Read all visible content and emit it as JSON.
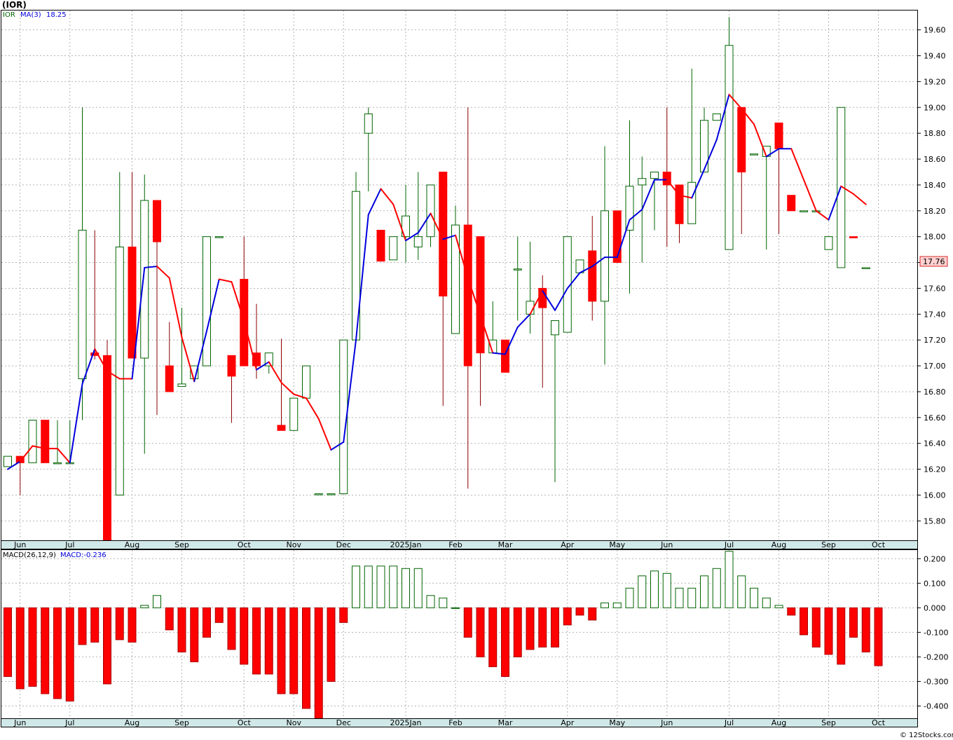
{
  "chart_title": "(IOR)",
  "credit": "© 12Stocks.com",
  "colors": {
    "up": "#006400",
    "down": "#ff0000",
    "ma_up": "#0000dd",
    "ma_down": "#ff0000",
    "grid": "#b4b4b4",
    "axis_band": "#d0e8e8",
    "frame": "#000000",
    "last_label_bg": "#ffd0d0"
  },
  "chart_data": [
    {
      "type": "candlestick",
      "ticker": "IOR",
      "legend": {
        "ticker": "IOR",
        "ma_label": "MA(3)",
        "ma_value": "18.25"
      },
      "ylim": [
        15.65,
        19.75
      ],
      "y_ticks": [
        "15.80",
        "16.00",
        "16.20",
        "16.40",
        "16.60",
        "16.80",
        "17.00",
        "17.20",
        "17.40",
        "17.60",
        "17.80",
        "18.00",
        "18.20",
        "18.40",
        "18.60",
        "18.80",
        "19.00",
        "19.20",
        "19.40",
        "19.60"
      ],
      "last_price": "17.76",
      "month_labels": [
        {
          "label": "Jun",
          "week": 1
        },
        {
          "label": "Jul",
          "week": 5
        },
        {
          "label": "Aug",
          "week": 10
        },
        {
          "label": "Sep",
          "week": 14
        },
        {
          "label": "Oct",
          "week": 19
        },
        {
          "label": "Nov",
          "week": 23
        },
        {
          "label": "Dec",
          "week": 27
        },
        {
          "label": "2025Jan",
          "week": 32
        },
        {
          "label": "Feb",
          "week": 36
        },
        {
          "label": "Mar",
          "week": 40
        },
        {
          "label": "Apr",
          "week": 45
        },
        {
          "label": "May",
          "week": 49
        },
        {
          "label": "Jun",
          "week": 53
        },
        {
          "label": "Jul",
          "week": 58
        },
        {
          "label": "Aug",
          "week": 62
        },
        {
          "label": "Sep",
          "week": 66
        },
        {
          "label": "Oct",
          "week": 70
        }
      ],
      "candles": [
        {
          "o": 16.22,
          "h": 16.3,
          "l": 16.22,
          "c": 16.3
        },
        {
          "o": 16.3,
          "h": 16.3,
          "l": 16.0,
          "c": 16.25
        },
        {
          "o": 16.25,
          "h": 16.58,
          "l": 16.25,
          "c": 16.58
        },
        {
          "o": 16.58,
          "h": 16.58,
          "l": 16.25,
          "c": 16.25
        },
        {
          "o": 16.25,
          "h": 16.58,
          "l": 16.25,
          "c": 16.25
        },
        {
          "o": 16.25,
          "h": 16.58,
          "l": 16.25,
          "c": 16.25
        },
        {
          "o": 16.9,
          "h": 19.0,
          "l": 16.58,
          "c": 18.05
        },
        {
          "o": 17.1,
          "h": 18.05,
          "l": 17.05,
          "c": 17.08
        },
        {
          "o": 17.08,
          "h": 17.2,
          "l": 15.65,
          "c": 15.65
        },
        {
          "o": 16.0,
          "h": 18.5,
          "l": 16.0,
          "c": 17.92
        },
        {
          "o": 17.92,
          "h": 18.5,
          "l": 17.06,
          "c": 17.06
        },
        {
          "o": 17.06,
          "h": 18.48,
          "l": 16.32,
          "c": 18.28
        },
        {
          "o": 18.28,
          "h": 18.28,
          "l": 16.62,
          "c": 17.96
        },
        {
          "o": 17.0,
          "h": 17.34,
          "l": 16.8,
          "c": 16.8
        },
        {
          "o": 16.84,
          "h": 17.45,
          "l": 16.84,
          "c": 16.86
        },
        {
          "o": 16.9,
          "h": 17.0,
          "l": 16.9,
          "c": 17.0
        },
        {
          "o": 17.0,
          "h": 18.0,
          "l": 17.0,
          "c": 18.0
        },
        {
          "o": 18.0,
          "h": 18.0,
          "l": 18.0,
          "c": 18.0
        },
        {
          "o": 17.08,
          "h": 17.05,
          "l": 16.56,
          "c": 16.92
        },
        {
          "o": 17.67,
          "h": 18.0,
          "l": 17.0,
          "c": 17.0
        },
        {
          "o": 17.1,
          "h": 17.48,
          "l": 16.9,
          "c": 17.0
        },
        {
          "o": 17.0,
          "h": 17.1,
          "l": 16.94,
          "c": 17.1
        },
        {
          "o": 16.54,
          "h": 17.21,
          "l": 16.5,
          "c": 16.5
        },
        {
          "o": 16.5,
          "h": 16.75,
          "l": 16.5,
          "c": 16.75
        },
        {
          "o": 16.75,
          "h": 17.0,
          "l": 16.75,
          "c": 17.0
        },
        {
          "o": 16.01,
          "h": 16.01,
          "l": 16.01,
          "c": 16.01
        },
        {
          "o": 16.01,
          "h": 16.01,
          "l": 16.01,
          "c": 16.01
        },
        {
          "o": 16.01,
          "h": 17.2,
          "l": 16.01,
          "c": 17.2
        },
        {
          "o": 17.2,
          "h": 18.5,
          "l": 17.2,
          "c": 18.35
        },
        {
          "o": 18.8,
          "h": 19.0,
          "l": 18.35,
          "c": 18.95
        },
        {
          "o": 18.05,
          "h": 18.05,
          "l": 17.81,
          "c": 17.81
        },
        {
          "o": 17.82,
          "h": 18.0,
          "l": 17.82,
          "c": 18.0
        },
        {
          "o": 18.0,
          "h": 18.4,
          "l": 17.8,
          "c": 18.16
        },
        {
          "o": 17.92,
          "h": 18.5,
          "l": 17.82,
          "c": 18.0
        },
        {
          "o": 18.0,
          "h": 18.4,
          "l": 17.92,
          "c": 18.4
        },
        {
          "o": 18.5,
          "h": 18.5,
          "l": 16.69,
          "c": 17.54
        },
        {
          "o": 17.25,
          "h": 18.24,
          "l": 17.25,
          "c": 18.09
        },
        {
          "o": 18.09,
          "h": 19.0,
          "l": 16.05,
          "c": 17.0
        },
        {
          "o": 18.0,
          "h": 18.0,
          "l": 16.69,
          "c": 17.1
        },
        {
          "o": 17.1,
          "h": 17.5,
          "l": 17.1,
          "c": 17.2
        },
        {
          "o": 17.2,
          "h": 17.2,
          "l": 16.95,
          "c": 16.95
        },
        {
          "o": 17.75,
          "h": 18.0,
          "l": 17.35,
          "c": 17.75
        },
        {
          "o": 17.4,
          "h": 17.96,
          "l": 17.25,
          "c": 17.5
        },
        {
          "o": 17.6,
          "h": 17.7,
          "l": 16.83,
          "c": 17.45
        },
        {
          "o": 17.24,
          "h": 17.35,
          "l": 16.1,
          "c": 17.35
        },
        {
          "o": 17.26,
          "h": 18.0,
          "l": 17.26,
          "c": 18.0
        },
        {
          "o": 17.72,
          "h": 17.82,
          "l": 17.72,
          "c": 17.82
        },
        {
          "o": 17.89,
          "h": 18.16,
          "l": 17.35,
          "c": 17.5
        },
        {
          "o": 17.5,
          "h": 18.7,
          "l": 17.01,
          "c": 18.2
        },
        {
          "o": 18.2,
          "h": 18.2,
          "l": 17.8,
          "c": 17.8
        },
        {
          "o": 18.05,
          "h": 18.9,
          "l": 17.56,
          "c": 18.39
        },
        {
          "o": 18.4,
          "h": 18.62,
          "l": 17.8,
          "c": 18.45
        },
        {
          "o": 18.45,
          "h": 18.5,
          "l": 18.05,
          "c": 18.5
        },
        {
          "o": 18.5,
          "h": 19.0,
          "l": 17.92,
          "c": 18.4
        },
        {
          "o": 18.4,
          "h": 18.4,
          "l": 17.95,
          "c": 18.1
        },
        {
          "o": 18.1,
          "h": 19.3,
          "l": 18.1,
          "c": 18.42
        },
        {
          "o": 18.5,
          "h": 19.0,
          "l": 18.5,
          "c": 18.9
        },
        {
          "o": 18.9,
          "h": 18.95,
          "l": 18.9,
          "c": 18.95
        },
        {
          "o": 17.9,
          "h": 19.7,
          "l": 17.9,
          "c": 19.48
        },
        {
          "o": 19.0,
          "h": 19.0,
          "l": 18.02,
          "c": 18.5
        },
        {
          "o": 18.64,
          "h": 18.64,
          "l": 18.64,
          "c": 18.64
        },
        {
          "o": 18.62,
          "h": 18.7,
          "l": 17.9,
          "c": 18.7
        },
        {
          "o": 18.88,
          "h": 18.88,
          "l": 18.02,
          "c": 18.68
        },
        {
          "o": 18.32,
          "h": 18.32,
          "l": 18.2,
          "c": 18.2
        },
        {
          "o": 18.2,
          "h": 18.2,
          "l": 18.2,
          "c": 18.2
        },
        {
          "o": 18.2,
          "h": 18.2,
          "l": 18.2,
          "c": 18.2
        },
        {
          "o": 17.9,
          "h": 18.0,
          "l": 17.9,
          "c": 18.0
        },
        {
          "o": 17.76,
          "h": 19.0,
          "l": 17.76,
          "c": 19.0
        },
        {
          "o": 18.0,
          "h": 18.0,
          "l": 17.99,
          "c": 17.99
        },
        {
          "o": 17.76,
          "h": 17.76,
          "l": 17.76,
          "c": 17.76
        }
      ],
      "ma3": [
        16.2,
        16.26,
        16.38,
        16.36,
        16.36,
        16.25,
        16.86,
        17.13,
        16.96,
        16.9,
        16.9,
        17.76,
        17.77,
        17.68,
        17.22,
        16.88,
        17.27,
        17.67,
        17.65,
        17.35,
        16.97,
        17.03,
        16.87,
        16.78,
        16.75,
        16.59,
        16.35,
        16.41,
        17.2,
        18.17,
        18.37,
        18.25,
        17.97,
        18.03,
        18.18,
        17.98,
        18.01,
        17.68,
        17.39,
        17.1,
        17.09,
        17.3,
        17.4,
        17.58,
        17.43,
        17.6,
        17.72,
        17.77,
        17.84,
        17.84,
        18.13,
        18.21,
        18.44,
        18.44,
        18.32,
        18.3,
        18.52,
        18.75,
        19.1,
        18.99,
        18.87,
        18.62,
        18.68,
        18.68,
        18.44,
        18.2,
        18.13,
        18.39,
        18.33,
        18.25
      ],
      "ma_colors": [
        "b",
        "b",
        "r",
        "r",
        "r",
        "r",
        "b",
        "b",
        "r",
        "r",
        "r",
        "b",
        "b",
        "r",
        "r",
        "r",
        "b",
        "b",
        "r",
        "r",
        "r",
        "b",
        "r",
        "r",
        "r",
        "r",
        "r",
        "b",
        "b",
        "b",
        "b",
        "r",
        "r",
        "b",
        "b",
        "r",
        "b",
        "r",
        "r",
        "r",
        "b",
        "b",
        "b",
        "r",
        "b",
        "b",
        "b",
        "b",
        "b",
        "b",
        "b",
        "b",
        "b",
        "b",
        "r",
        "r",
        "b",
        "b",
        "b",
        "r",
        "r",
        "r",
        "b",
        "b",
        "r",
        "r",
        "r",
        "b",
        "r",
        "r"
      ]
    },
    {
      "type": "bar",
      "name": "MACD",
      "legend": {
        "label": "MACD(26,12,9)",
        "value_label": "MACD:-0.236"
      },
      "ylim": [
        -0.45,
        0.235
      ],
      "y_ticks": [
        "0.200",
        "0.100",
        "0.000",
        "-0.100",
        "-0.200",
        "-0.300",
        "-0.400"
      ],
      "values": [
        -0.28,
        -0.33,
        -0.32,
        -0.35,
        -0.37,
        -0.38,
        -0.15,
        -0.14,
        -0.31,
        -0.13,
        -0.14,
        0.01,
        0.05,
        -0.09,
        -0.18,
        -0.22,
        -0.12,
        -0.06,
        -0.17,
        -0.23,
        -0.27,
        -0.27,
        -0.35,
        -0.35,
        -0.41,
        -0.45,
        -0.3,
        -0.06,
        0.17,
        0.17,
        0.17,
        0.17,
        0.16,
        0.16,
        0.05,
        0.04,
        0.0,
        -0.12,
        -0.2,
        -0.24,
        -0.28,
        -0.2,
        -0.17,
        -0.16,
        -0.16,
        -0.07,
        -0.03,
        -0.05,
        0.02,
        0.02,
        0.08,
        0.13,
        0.15,
        0.14,
        0.08,
        0.08,
        0.13,
        0.16,
        0.23,
        0.13,
        0.08,
        0.04,
        0.01,
        -0.03,
        -0.11,
        -0.16,
        -0.19,
        -0.23,
        -0.12,
        -0.18,
        -0.236
      ]
    }
  ]
}
